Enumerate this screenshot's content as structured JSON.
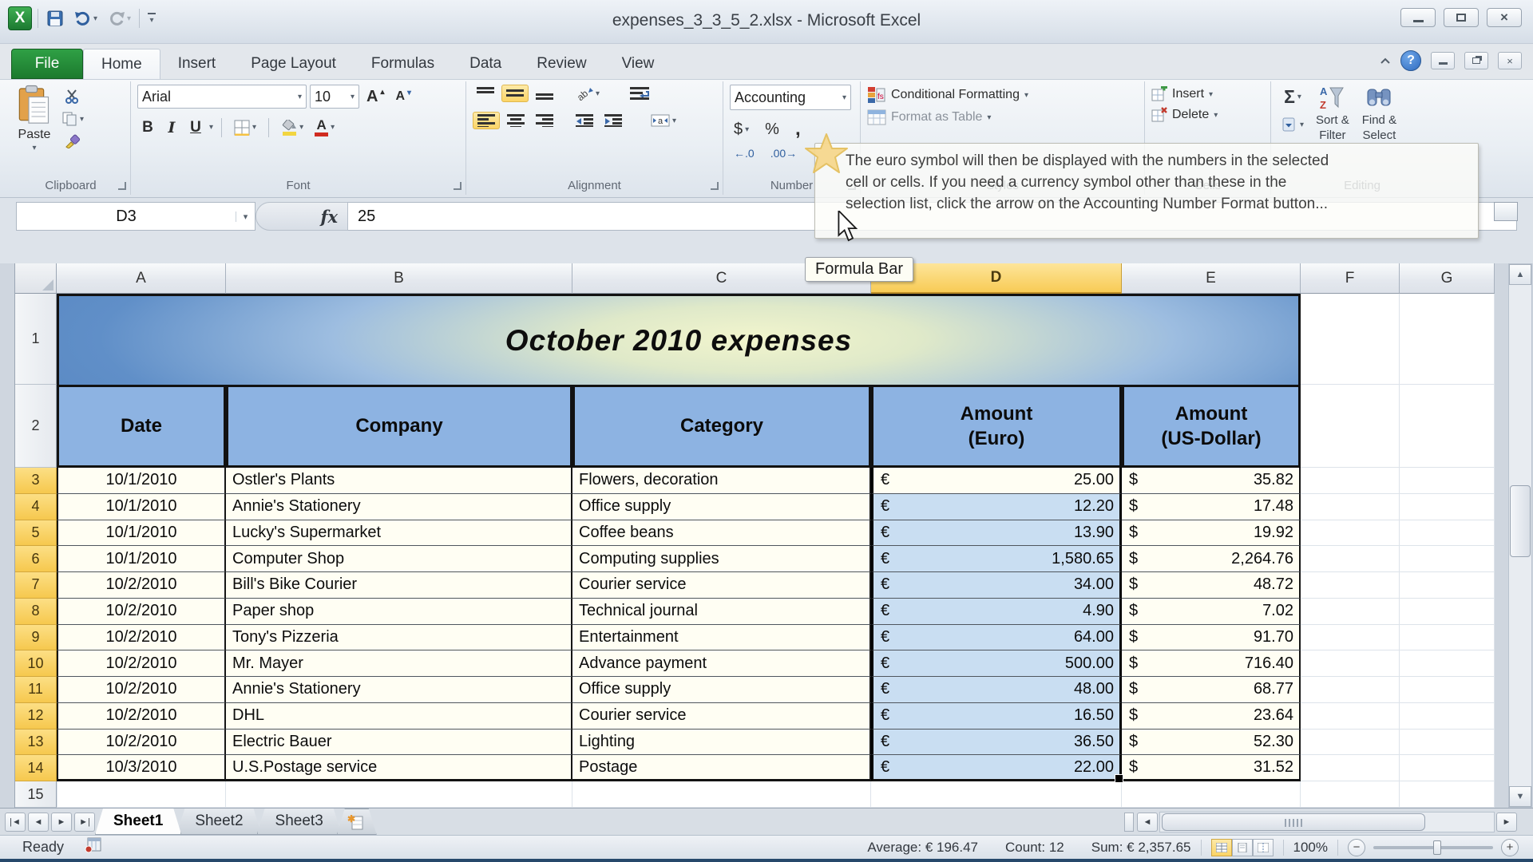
{
  "window": {
    "title": "expenses_3_3_5_2.xlsx  -  Microsoft Excel"
  },
  "ribbon_tabs": {
    "file": "File",
    "items": [
      "Home",
      "Insert",
      "Page Layout",
      "Formulas",
      "Data",
      "Review",
      "View"
    ]
  },
  "ribbon": {
    "clipboard": {
      "group": "Clipboard",
      "paste": "Paste"
    },
    "font": {
      "group": "Font",
      "family": "Arial",
      "size": "10",
      "bold": "B",
      "italic": "I",
      "underline": "U",
      "color_letter": "A"
    },
    "alignment": {
      "group": "Alignment"
    },
    "number": {
      "group": "Number",
      "format": "Accounting",
      "currency": "$",
      "percent": "%",
      "comma": ",",
      "inc_decimal": "←.0",
      "dec_decimal": ".00→"
    },
    "styles": {
      "group": "Styles",
      "conditional_formatting": "Conditional Formatting",
      "format_as_table": "Format as Table"
    },
    "cells": {
      "group": "Cells",
      "insert": "Insert",
      "delete": "Delete"
    },
    "editing": {
      "group": "Editing",
      "autosum": "Σ",
      "sort_line1": "Sort &",
      "sort_line2": "Filter",
      "find_line1": "Find &",
      "find_line2": "Select"
    }
  },
  "tooltip": {
    "line1": "The euro symbol will then be displayed with the numbers in the selected",
    "line2": "cell or cells. If you need a currency symbol other than these in the",
    "line3": "selection list, click the arrow on the Accounting Number Format button..."
  },
  "formula_bar": {
    "name_box": "D3",
    "fx": "fx",
    "value": "25",
    "tooltip": "Formula Bar"
  },
  "grid": {
    "columns": [
      "A",
      "B",
      "C",
      "D",
      "E",
      "F",
      "G"
    ],
    "selected_column": "D",
    "eur_symbol": "€",
    "usd_symbol": "$",
    "title_row_number": "1",
    "title": "October 2010 expenses",
    "header_row_number": "2",
    "headers": [
      {
        "title": "Date",
        "sub": ""
      },
      {
        "title": "Company",
        "sub": ""
      },
      {
        "title": "Category",
        "sub": ""
      },
      {
        "title": "Amount",
        "sub": "(Euro)"
      },
      {
        "title": "Amount",
        "sub": "(US-Dollar)"
      }
    ],
    "rows": [
      {
        "n": "3",
        "date": "10/1/2010",
        "company": "Ostler's Plants",
        "category": "Flowers, decoration",
        "eur": "25.00",
        "usd": "35.82"
      },
      {
        "n": "4",
        "date": "10/1/2010",
        "company": "Annie's Stationery",
        "category": "Office supply",
        "eur": "12.20",
        "usd": "17.48"
      },
      {
        "n": "5",
        "date": "10/1/2010",
        "company": "Lucky's Supermarket",
        "category": "Coffee beans",
        "eur": "13.90",
        "usd": "19.92"
      },
      {
        "n": "6",
        "date": "10/1/2010",
        "company": "Computer Shop",
        "category": "Computing supplies",
        "eur": "1,580.65",
        "usd": "2,264.76"
      },
      {
        "n": "7",
        "date": "10/2/2010",
        "company": "Bill's Bike Courier",
        "category": "Courier service",
        "eur": "34.00",
        "usd": "48.72"
      },
      {
        "n": "8",
        "date": "10/2/2010",
        "company": "Paper shop",
        "category": "Technical journal",
        "eur": "4.90",
        "usd": "7.02"
      },
      {
        "n": "9",
        "date": "10/2/2010",
        "company": "Tony's Pizzeria",
        "category": "Entertainment",
        "eur": "64.00",
        "usd": "91.70"
      },
      {
        "n": "10",
        "date": "10/2/2010",
        "company": "Mr. Mayer",
        "category": "Advance payment",
        "eur": "500.00",
        "usd": "716.40"
      },
      {
        "n": "11",
        "date": "10/2/2010",
        "company": "Annie's Stationery",
        "category": "Office supply",
        "eur": "48.00",
        "usd": "68.77"
      },
      {
        "n": "12",
        "date": "10/2/2010",
        "company": "DHL",
        "category": "Courier service",
        "eur": "16.50",
        "usd": "23.64"
      },
      {
        "n": "13",
        "date": "10/2/2010",
        "company": "Electric Bauer",
        "category": "Lighting",
        "eur": "36.50",
        "usd": "52.30"
      },
      {
        "n": "14",
        "date": "10/3/2010",
        "company": "U.S.Postage service",
        "category": "Postage",
        "eur": "22.00",
        "usd": "31.52"
      }
    ],
    "next_row_number": "15"
  },
  "sheet_tabs": {
    "items": [
      "Sheet1",
      "Sheet2",
      "Sheet3"
    ],
    "active": "Sheet1"
  },
  "status": {
    "mode": "Ready",
    "average": "Average: € 196.47",
    "count": "Count: 12",
    "sum": "Sum: € 2,357.65",
    "zoom_level": "100%"
  }
}
